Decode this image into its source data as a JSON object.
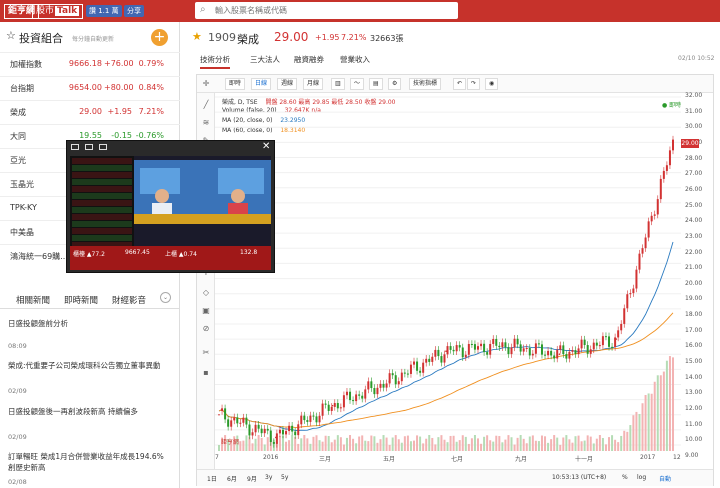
{
  "header": {
    "brand": "鉅亨網",
    "talk_label_1": "股市",
    "talk_label_2": "Talk",
    "fb_like": "讚 1.1 萬",
    "fb_share": "分享",
    "search_placeholder": "輸入股票名稱或代碼"
  },
  "portfolio": {
    "star": "☆",
    "title": "投資組合",
    "note": "每分鐘自動更新",
    "add_icon": "+",
    "rows": [
      {
        "name": "加權指數",
        "price": "9666.18",
        "change": "+76.00",
        "pct": "0.79%",
        "dir": "up"
      },
      {
        "name": "台指期",
        "price": "9654.00",
        "change": "+80.00",
        "pct": "0.84%",
        "dir": "up"
      },
      {
        "name": "榮成",
        "price": "29.00",
        "change": "+1.95",
        "pct": "7.21%",
        "dir": "up"
      },
      {
        "name": "大同",
        "price": "19.55",
        "change": "-0.15",
        "pct": "-0.76%",
        "dir": "dn"
      },
      {
        "name": "亞光",
        "price": "",
        "change": "",
        "pct": "",
        "dir": "up"
      },
      {
        "name": "玉晶光",
        "price": "",
        "change": "",
        "pct": "",
        "dir": "up"
      },
      {
        "name": "TPK-KY",
        "price": "",
        "change": "",
        "pct": "",
        "dir": "up"
      },
      {
        "name": "中美晶",
        "price": "",
        "change": "",
        "pct": "",
        "dir": "up"
      },
      {
        "name": "鴻海統一69購...",
        "price": "",
        "change": "",
        "pct": "",
        "dir": "up"
      }
    ]
  },
  "news": {
    "tabs": [
      "相關新聞",
      "即時新聞",
      "財經影音"
    ],
    "chevron": "⌄",
    "items": [
      {
        "title": "日盛投顧盤前分析",
        "date": "08:09"
      },
      {
        "title": "榮成:代重要子公司榮成環科公告獨立董事異動",
        "date": "02/09"
      },
      {
        "title": "日盛投顧盤後一再創波段新高 持續偏多",
        "date": "02/09"
      },
      {
        "title": "訂單暢旺 榮成1月合併營業收益年成長194.6% 創歷史新高",
        "date": "02/08"
      }
    ]
  },
  "stock": {
    "star": "★",
    "code": "1909",
    "name": "榮成",
    "price": "29.00",
    "change": "+1.95",
    "pct": "7.21%",
    "volume": "32663張",
    "time": "02/10 10:52",
    "tabs": [
      "技術分析",
      "三大法人",
      "融資融券",
      "營業收入"
    ]
  },
  "chart_toolbar": {
    "buttons": [
      "即時",
      "日線",
      "週線",
      "月線",
      "技術指標"
    ],
    "undo": "↶",
    "redo": "↷",
    "camera": "◉"
  },
  "legend": {
    "main": "榮成, D, TSE",
    "ohlc": "開盤 28.60  最高 29.85  最低 28.50  收盤 29.00",
    "volume_label": "Volume (false, 20)",
    "volume_value": "32.647K  n/a",
    "ma20_label": "MA (20, close, 0)",
    "ma20_value": "23.2950",
    "ma60_label": "MA (60, close, 0)",
    "ma60_value": "18.3140",
    "live": "● 即時"
  },
  "price_axis": [
    "32.00",
    "31.00",
    "30.00",
    "29.00",
    "28.00",
    "27.00",
    "26.00",
    "25.00",
    "24.00",
    "23.00",
    "22.00",
    "21.00",
    "20.00",
    "19.00",
    "18.00",
    "17.00",
    "16.00",
    "15.00",
    "14.00",
    "13.00",
    "12.00",
    "11.00",
    "10.00",
    "9.00"
  ],
  "price_tag": "29.00",
  "time_axis": [
    "7",
    "2016",
    "三月",
    "五月",
    "七月",
    "九月",
    "十一月",
    "2017",
    "12"
  ],
  "bottom_bar": {
    "ranges": [
      "1日",
      "6月",
      "9月",
      "3y",
      "5y"
    ],
    "clock": "10:53:13 (UTC+8)",
    "pct": "%",
    "log": "log",
    "auto": "自動"
  },
  "watermark": "鉅亨網",
  "chart_data": {
    "type": "line",
    "title": "榮成, D, TSE",
    "x": [
      "2015-12",
      "2016-01",
      "2016-03",
      "2016-05",
      "2016-07",
      "2016-09",
      "2016-11",
      "2017-01",
      "2017-02"
    ],
    "series": [
      {
        "values": [
          11.0,
          9.5,
          11.6,
          13.2,
          15.2,
          15.6,
          15.0,
          16.0,
          29.0
        ]
      }
    ],
    "ylim": [
      9,
      32
    ]
  },
  "pip": {
    "close": "✕",
    "ticker_1": "櫃檯 ▲77.2",
    "ticker_2": "9667.45",
    "ticker_3": "上櫃 ▲0.74",
    "ticker_4": "132.8"
  }
}
